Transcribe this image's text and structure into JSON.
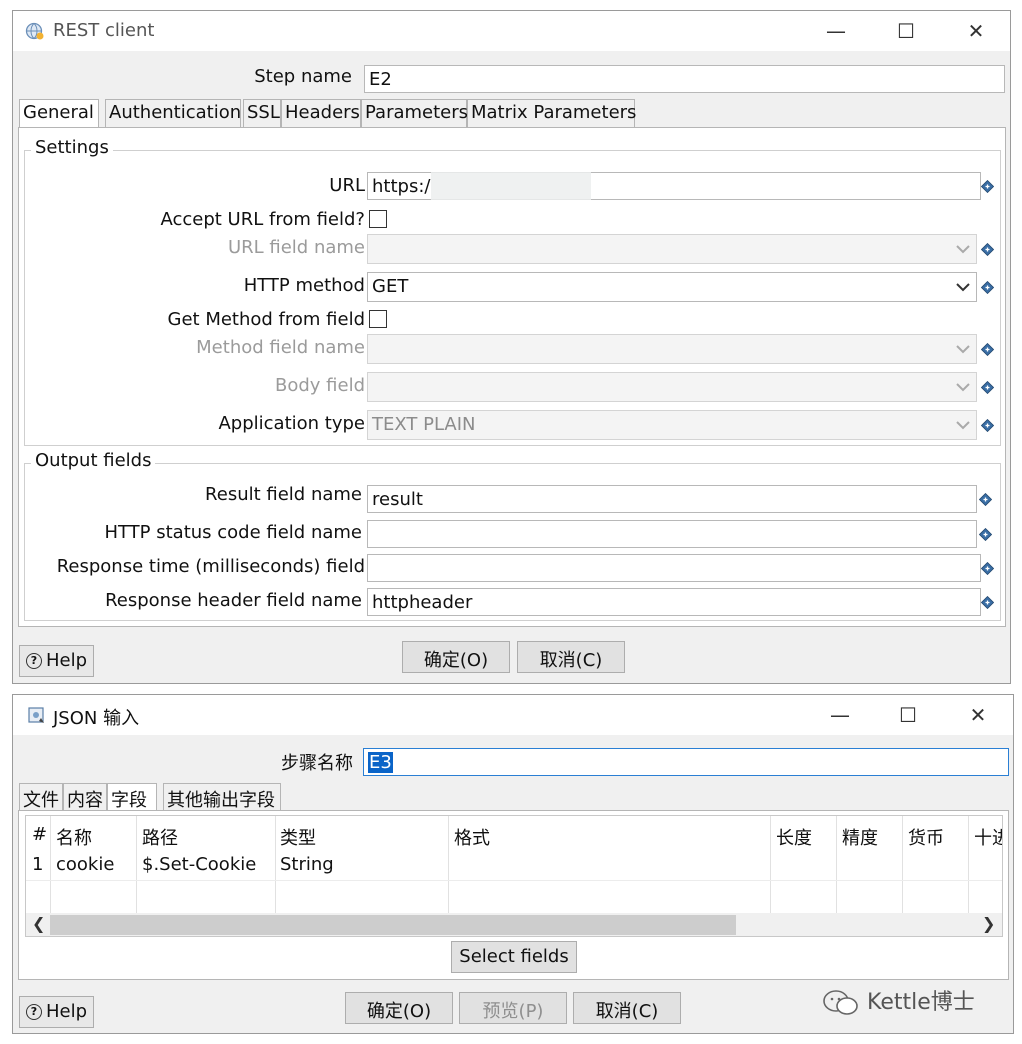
{
  "rest_dialog": {
    "title": "REST client",
    "step_name_label": "Step name",
    "step_name_value": "E2",
    "tabs": [
      "General",
      "Authentication",
      "SSL",
      "Headers",
      "Parameters",
      "Matrix Parameters"
    ],
    "settings_group": "Settings",
    "url_label": "URL",
    "url_value": "https:/",
    "accept_url_label": "Accept URL from field?",
    "url_field_name_label": "URL field name",
    "http_method_label": "HTTP method",
    "http_method_value": "GET",
    "get_method_label": "Get Method from field",
    "method_field_name_label": "Method field name",
    "body_field_label": "Body field",
    "application_type_label": "Application type",
    "application_type_value": "TEXT PLAIN",
    "output_group": "Output fields",
    "result_field_label": "Result field name",
    "result_field_value": "result",
    "http_status_label": "HTTP status code field name",
    "response_time_label": "Response time (milliseconds) field",
    "response_header_label": "Response header field name",
    "response_header_value": "httpheader",
    "help_label": "Help",
    "ok_label": "确定(O)",
    "cancel_label": "取消(C)"
  },
  "json_dialog": {
    "title": "JSON 输入",
    "step_name_label": "步骤名称",
    "step_name_value": "E3",
    "tabs": [
      "文件",
      "内容",
      "字段",
      "其他输出字段"
    ],
    "columns": [
      "#",
      "名称",
      "路径",
      "类型",
      "格式",
      "长度",
      "精度",
      "货币",
      "十进"
    ],
    "rows": [
      [
        "1",
        "cookie",
        "$.Set-Cookie",
        "String",
        "",
        "",
        "",
        "",
        ""
      ]
    ],
    "select_fields_label": "Select fields",
    "help_label": "Help",
    "ok_label": "确定(O)",
    "preview_label": "预览(P)",
    "cancel_label": "取消(C)"
  },
  "watermark": "Kettle博士",
  "icons": {
    "rest": "globe-icon",
    "json": "json-input-icon",
    "variable": "variable-diamond-icon",
    "dropdown": "chevron-down-icon",
    "help": "question-circle-icon"
  }
}
